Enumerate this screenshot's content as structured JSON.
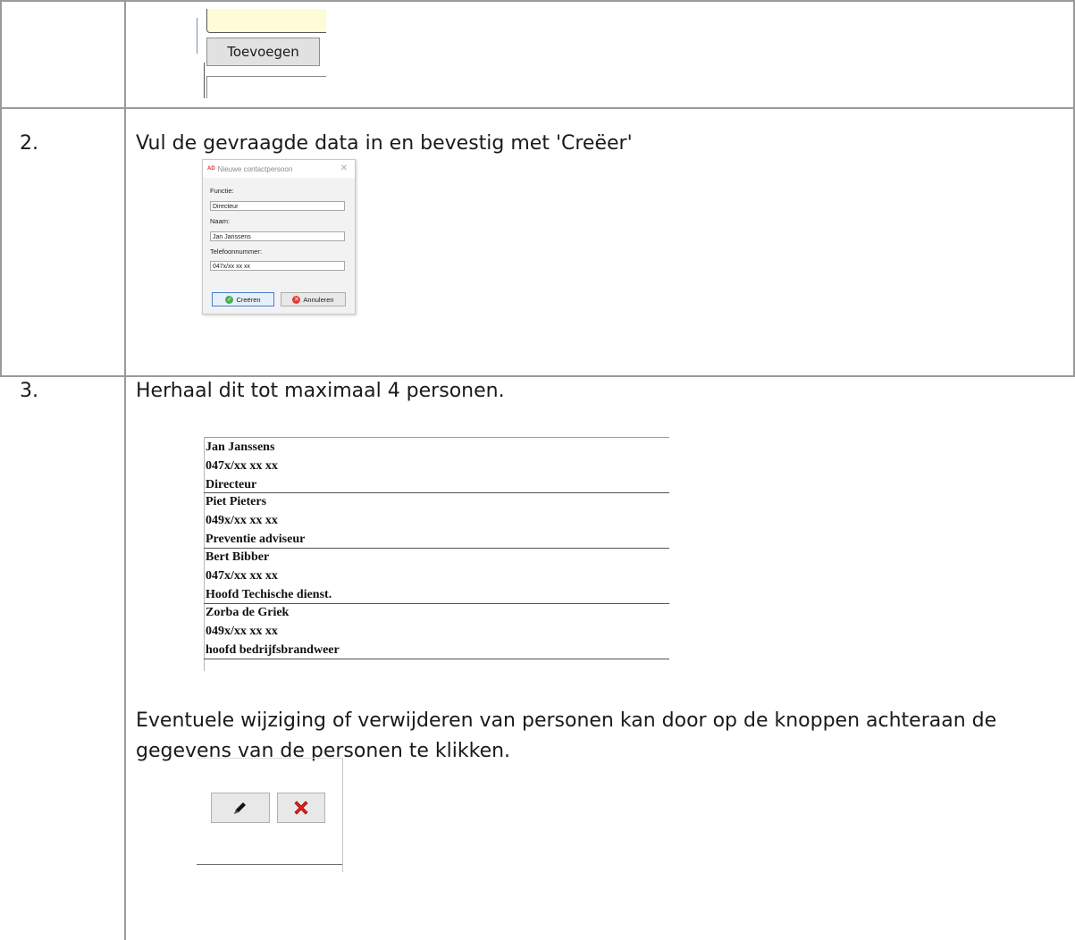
{
  "top_fragment": {
    "add_button_label": "Toevoegen"
  },
  "steps": [
    {
      "number": "2.",
      "text": "Vul de gevraagde data in en bevestig met 'Creëer'"
    },
    {
      "number": "3.",
      "text": "Herhaal dit tot maximaal 4 personen."
    }
  ],
  "dialog": {
    "title": "Nieuwe contactpersoon",
    "logo": "AD",
    "fields": [
      {
        "label": "Functie:",
        "value": "Directeur"
      },
      {
        "label": "Naam:",
        "value": "Jan Janssens"
      },
      {
        "label": "Telefoonnummer:",
        "value": "047x/xx xx xx"
      }
    ],
    "create_label": "Creëren",
    "cancel_label": "Annuleren"
  },
  "persons": [
    {
      "name": "Jan Janssens",
      "phone": "047x/xx xx xx",
      "role": "Directeur"
    },
    {
      "name": "Piet Pieters",
      "phone": "049x/xx xx xx",
      "role": "Preventie adviseur"
    },
    {
      "name": "Bert Bibber",
      "phone": "047x/xx xx xx",
      "role": "Hoofd Techische dienst."
    },
    {
      "name": "Zorba de Griek",
      "phone": "049x/xx xx xx",
      "role": "hoofd bedrijfsbrandweer"
    }
  ],
  "edit_note_line1": "Eventuele wijziging of verwijderen van personen kan door op de knoppen achteraan de",
  "edit_note_line2": "gegevens van de personen te klikken.",
  "icons": {
    "edit": "pencil-icon",
    "delete": "red-x-icon"
  }
}
